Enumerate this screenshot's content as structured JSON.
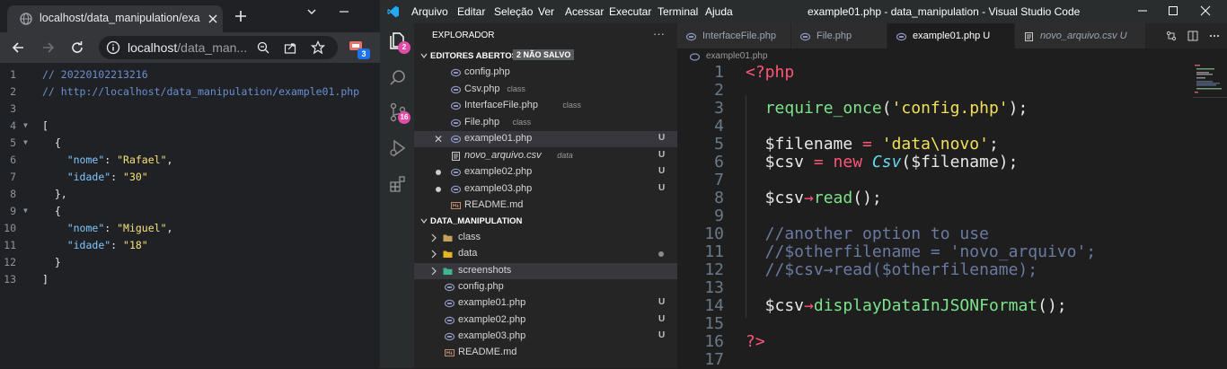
{
  "browser": {
    "tab_title": "localhost/data_manipulation/exa",
    "url_host": "localhost",
    "url_path": "/data_man...",
    "extension_badge": "3",
    "json_lines": [
      {
        "n": "1",
        "fold": false,
        "parts": [
          {
            "t": "// 20220102213216",
            "c": "cmt"
          }
        ]
      },
      {
        "n": "2",
        "fold": false,
        "parts": [
          {
            "t": "// http://localhost/data_manipulation/example01.php",
            "c": "cmt"
          }
        ]
      },
      {
        "n": "3",
        "fold": false,
        "parts": []
      },
      {
        "n": "4",
        "fold": true,
        "parts": [
          {
            "t": "[",
            "c": ""
          }
        ]
      },
      {
        "n": "5",
        "fold": true,
        "parts": [
          {
            "t": "  {",
            "c": ""
          }
        ]
      },
      {
        "n": "6",
        "fold": false,
        "parts": [
          {
            "t": "    ",
            "c": ""
          },
          {
            "t": "\"nome\"",
            "c": "key"
          },
          {
            "t": ": ",
            "c": ""
          },
          {
            "t": "\"Rafael\"",
            "c": "str"
          },
          {
            "t": ",",
            "c": ""
          }
        ]
      },
      {
        "n": "7",
        "fold": false,
        "parts": [
          {
            "t": "    ",
            "c": ""
          },
          {
            "t": "\"idade\"",
            "c": "key"
          },
          {
            "t": ": ",
            "c": ""
          },
          {
            "t": "\"30\"",
            "c": "str"
          }
        ]
      },
      {
        "n": "8",
        "fold": false,
        "parts": [
          {
            "t": "  },",
            "c": ""
          }
        ]
      },
      {
        "n": "9",
        "fold": true,
        "parts": [
          {
            "t": "  {",
            "c": ""
          }
        ]
      },
      {
        "n": "10",
        "fold": false,
        "parts": [
          {
            "t": "    ",
            "c": ""
          },
          {
            "t": "\"nome\"",
            "c": "key"
          },
          {
            "t": ": ",
            "c": ""
          },
          {
            "t": "\"Miguel\"",
            "c": "str"
          },
          {
            "t": ",",
            "c": ""
          }
        ]
      },
      {
        "n": "11",
        "fold": false,
        "parts": [
          {
            "t": "    ",
            "c": ""
          },
          {
            "t": "\"idade\"",
            "c": "key"
          },
          {
            "t": ": ",
            "c": ""
          },
          {
            "t": "\"18\"",
            "c": "str"
          }
        ]
      },
      {
        "n": "12",
        "fold": false,
        "parts": [
          {
            "t": "  }",
            "c": ""
          }
        ]
      },
      {
        "n": "13",
        "fold": false,
        "parts": [
          {
            "t": "]",
            "c": ""
          }
        ]
      }
    ]
  },
  "vscode": {
    "menu": [
      "Arquivo",
      "Editar",
      "Seleção",
      "Ver",
      "Acessar",
      "Executar",
      "Terminal",
      "Ajuda"
    ],
    "window_title": "example01.php - data_manipulation - Visual Studio Code",
    "activity_badges": {
      "explorer": "2",
      "scm": "16"
    },
    "explorer_title": "EXPLORADOR",
    "open_editors_label": "EDITORES ABERTOS",
    "unsaved_label": "2 NÃO SALVO",
    "open_editors": [
      {
        "name": "config.php",
        "desc": "",
        "status": "",
        "marker": "",
        "italic": false,
        "selected": false
      },
      {
        "name": "Csv.php",
        "desc": "class",
        "status": "",
        "marker": "",
        "italic": false,
        "selected": false
      },
      {
        "name": "InterfaceFile.php",
        "desc": "class",
        "status": "",
        "marker": "",
        "italic": false,
        "selected": false
      },
      {
        "name": "File.php",
        "desc": "class",
        "status": "",
        "marker": "",
        "italic": false,
        "selected": false
      },
      {
        "name": "example01.php",
        "desc": "",
        "status": "U",
        "marker": "close",
        "italic": false,
        "selected": true
      },
      {
        "name": "novo_arquivo.csv",
        "desc": "data",
        "status": "U",
        "marker": "",
        "italic": true,
        "selected": false
      },
      {
        "name": "example02.php",
        "desc": "",
        "status": "U",
        "marker": "dot",
        "italic": false,
        "selected": false
      },
      {
        "name": "example03.php",
        "desc": "",
        "status": "U",
        "marker": "dot",
        "italic": false,
        "selected": false
      },
      {
        "name": "README.md",
        "desc": "",
        "status": "",
        "marker": "",
        "italic": false,
        "selected": false
      }
    ],
    "workspace_label": "DATA_MANIPULATION",
    "workspace": [
      {
        "name": "class",
        "kind": "folder",
        "status": ""
      },
      {
        "name": "data",
        "kind": "folder",
        "status": "dot"
      },
      {
        "name": "screenshots",
        "kind": "folder",
        "status": ""
      },
      {
        "name": "config.php",
        "kind": "php",
        "status": ""
      },
      {
        "name": "example01.php",
        "kind": "php",
        "status": "U"
      },
      {
        "name": "example02.php",
        "kind": "php",
        "status": "U"
      },
      {
        "name": "example03.php",
        "kind": "php",
        "status": "U"
      },
      {
        "name": "README.md",
        "kind": "md",
        "status": ""
      }
    ],
    "tabs": [
      {
        "label": "InterfaceFile.php",
        "active": false,
        "italic": false
      },
      {
        "label": "File.php",
        "active": false,
        "italic": false
      },
      {
        "label": "example01.php U",
        "active": true,
        "italic": false
      },
      {
        "label": "novo_arquivo.csv U",
        "active": false,
        "italic": true
      }
    ],
    "breadcrumb": "example01.php",
    "code_lines": [
      {
        "n": "1",
        "parts": [
          {
            "t": "<?php",
            "c": "php"
          }
        ]
      },
      {
        "n": "2",
        "parts": []
      },
      {
        "n": "3",
        "parts": [
          {
            "t": "  ",
            "c": ""
          },
          {
            "t": "require_once",
            "c": "fn"
          },
          {
            "t": "(",
            "c": ""
          },
          {
            "t": "'config.php'",
            "c": "sq"
          },
          {
            "t": ");",
            "c": ""
          }
        ]
      },
      {
        "n": "4",
        "parts": []
      },
      {
        "n": "5",
        "parts": [
          {
            "t": "  $filename",
            "c": "var"
          },
          {
            "t": " = ",
            "c": "op"
          },
          {
            "t": "'data\\novo'",
            "c": "sq"
          },
          {
            "t": ";",
            "c": ""
          }
        ]
      },
      {
        "n": "6",
        "parts": [
          {
            "t": "  $csv",
            "c": "var"
          },
          {
            "t": " = ",
            "c": "op"
          },
          {
            "t": "new ",
            "c": "kw"
          },
          {
            "t": "Csv",
            "c": "cls"
          },
          {
            "t": "($filename);",
            "c": ""
          }
        ]
      },
      {
        "n": "7",
        "parts": []
      },
      {
        "n": "8",
        "parts": [
          {
            "t": "  $csv",
            "c": "var"
          },
          {
            "t": "→",
            "c": "op"
          },
          {
            "t": "read",
            "c": "fn"
          },
          {
            "t": "();",
            "c": ""
          }
        ]
      },
      {
        "n": "9",
        "parts": []
      },
      {
        "n": "10",
        "parts": [
          {
            "t": "  //another option to use",
            "c": "cm"
          }
        ]
      },
      {
        "n": "11",
        "parts": [
          {
            "t": "  //$otherfilename = 'novo_arquivo';",
            "c": "cm"
          }
        ]
      },
      {
        "n": "12",
        "parts": [
          {
            "t": "  //$csv→read($otherfilename);",
            "c": "cm"
          }
        ]
      },
      {
        "n": "13",
        "parts": []
      },
      {
        "n": "14",
        "parts": [
          {
            "t": "  $csv",
            "c": "var"
          },
          {
            "t": "→",
            "c": "op"
          },
          {
            "t": "displayDataInJSONFormat",
            "c": "fn"
          },
          {
            "t": "();",
            "c": ""
          }
        ]
      },
      {
        "n": "15",
        "parts": []
      },
      {
        "n": "16",
        "parts": [
          {
            "t": "?>",
            "c": "php"
          }
        ]
      },
      {
        "n": "17",
        "parts": []
      }
    ]
  }
}
